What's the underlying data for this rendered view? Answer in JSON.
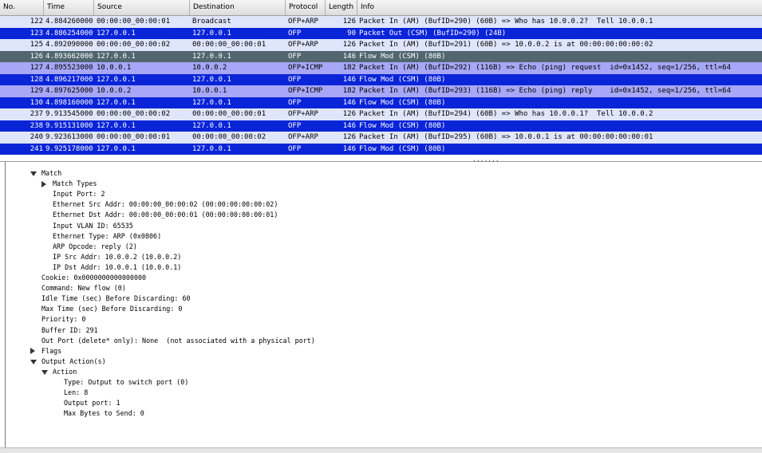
{
  "columns": {
    "no": "No.",
    "time": "Time",
    "source": "Source",
    "destination": "Destination",
    "protocol": "Protocol",
    "length": "Length",
    "info": "Info"
  },
  "packets": [
    {
      "no": "122",
      "time": "4.884260000",
      "src": "00:00:00_00:00:01",
      "dst": "Broadcast",
      "proto": "OFP+ARP",
      "len": "126",
      "info": "Packet In (AM) (BufID=290) (60B) => Who has 10.0.0.2?  Tell 10.0.0.1",
      "style": "light"
    },
    {
      "no": "123",
      "time": "4.886254000",
      "src": "127.0.0.1",
      "dst": "127.0.0.1",
      "proto": "OFP",
      "len": "90",
      "info": "Packet Out (CSM) (BufID=290) (24B)",
      "style": "blue"
    },
    {
      "no": "125",
      "time": "4.892090000",
      "src": "00:00:00_00:00:02",
      "dst": "00:00:00_00:00:01",
      "proto": "OFP+ARP",
      "len": "126",
      "info": "Packet In (AM) (BufID=291) (60B) => 10.0.0.2 is at 00:00:00:00:00:02",
      "style": "light"
    },
    {
      "no": "126",
      "time": "4.893662000",
      "src": "127.0.0.1",
      "dst": "127.0.0.1",
      "proto": "OFP",
      "len": "146",
      "info": "Flow Mod (CSM) (80B)",
      "style": "gray"
    },
    {
      "no": "127",
      "time": "4.895523000",
      "src": "10.0.0.1",
      "dst": "10.0.0.2",
      "proto": "OFP+ICMP",
      "len": "182",
      "info": "Packet In (AM) (BufID=292) (116B) => Echo (ping) request  id=0x1452, seq=1/256, ttl=64",
      "style": "lav"
    },
    {
      "no": "128",
      "time": "4.896217000",
      "src": "127.0.0.1",
      "dst": "127.0.0.1",
      "proto": "OFP",
      "len": "146",
      "info": "Flow Mod (CSM) (80B)",
      "style": "blue"
    },
    {
      "no": "129",
      "time": "4.897625000",
      "src": "10.0.0.2",
      "dst": "10.0.0.1",
      "proto": "OFP+ICMP",
      "len": "182",
      "info": "Packet In (AM) (BufID=293) (116B) => Echo (ping) reply    id=0x1452, seq=1/256, ttl=64",
      "style": "lav"
    },
    {
      "no": "130",
      "time": "4.898160000",
      "src": "127.0.0.1",
      "dst": "127.0.0.1",
      "proto": "OFP",
      "len": "146",
      "info": "Flow Mod (CSM) (80B)",
      "style": "blue"
    },
    {
      "no": "237",
      "time": "9.913545000",
      "src": "00:00:00_00:00:02",
      "dst": "00:00:00_00:00:01",
      "proto": "OFP+ARP",
      "len": "126",
      "info": "Packet In (AM) (BufID=294) (60B) => Who has 10.0.0.1?  Tell 10.0.0.2",
      "style": "light"
    },
    {
      "no": "238",
      "time": "9.915131000",
      "src": "127.0.0.1",
      "dst": "127.0.0.1",
      "proto": "OFP",
      "len": "146",
      "info": "Flow Mod (CSM) (80B)",
      "style": "blue"
    },
    {
      "no": "240",
      "time": "9.923613000",
      "src": "00:00:00_00:00:01",
      "dst": "00:00:00_00:00:02",
      "proto": "OFP+ARP",
      "len": "126",
      "info": "Packet In (AM) (BufID=295) (60B) => 10.0.0.1 is at 00:00:00:00:00:01",
      "style": "light"
    },
    {
      "no": "241",
      "time": "9.925178000",
      "src": "127.0.0.1",
      "dst": "127.0.0.1",
      "proto": "OFP",
      "len": "146",
      "info": "Flow Mod (CSM) (80B)",
      "style": "blue"
    }
  ],
  "detail_tree": [
    {
      "text": "Match",
      "expander": "down"
    },
    {
      "text": "Match Types",
      "expander": "right"
    },
    {
      "text": "Input Port: 2",
      "expander": ""
    },
    {
      "text": "Ethernet Src Addr: 00:00:00_00:00:02 (00:00:00:00:00:02)",
      "expander": ""
    },
    {
      "text": "Ethernet Dst Addr: 00:00:00_00:00:01 (00:00:00:00:00:01)",
      "expander": ""
    },
    {
      "text": "Input VLAN ID: 65535",
      "expander": ""
    },
    {
      "text": "Ethernet Type: ARP (0x0806)",
      "expander": ""
    },
    {
      "text": "ARP Opcode: reply (2)",
      "expander": ""
    },
    {
      "text": "IP Src Addr: 10.0.0.2 (10.0.0.2)",
      "expander": ""
    },
    {
      "text": "IP Dst Addr: 10.0.0.1 (10.0.0.1)",
      "expander": ""
    },
    {
      "text": "Cookie: 0x0000000000000000",
      "expander": ""
    },
    {
      "text": "Command: New flow (0)",
      "expander": ""
    },
    {
      "text": "Idle Time (sec) Before Discarding: 60",
      "expander": ""
    },
    {
      "text": "Max Time (sec) Before Discarding: 0",
      "expander": ""
    },
    {
      "text": "Priority: 0",
      "expander": ""
    },
    {
      "text": "Buffer ID: 291",
      "expander": ""
    },
    {
      "text": "Out Port (delete* only): None  (not associated with a physical port)",
      "expander": ""
    },
    {
      "text": "Flags",
      "expander": "right"
    },
    {
      "text": "Output Action(s)",
      "expander": "down"
    },
    {
      "text": "Action",
      "expander": "down"
    },
    {
      "text": "Type: Output to switch port (0)",
      "expander": ""
    },
    {
      "text": "Len: 8",
      "expander": ""
    },
    {
      "text": "Output port: 1",
      "expander": ""
    },
    {
      "text": "Max Bytes to Send: 0",
      "expander": ""
    }
  ],
  "colors": {
    "row_light": "#dfe6fb",
    "row_selected_blue": "#0a24d8",
    "row_gray": "#51666e",
    "row_lavender": "#a7a7f7"
  }
}
